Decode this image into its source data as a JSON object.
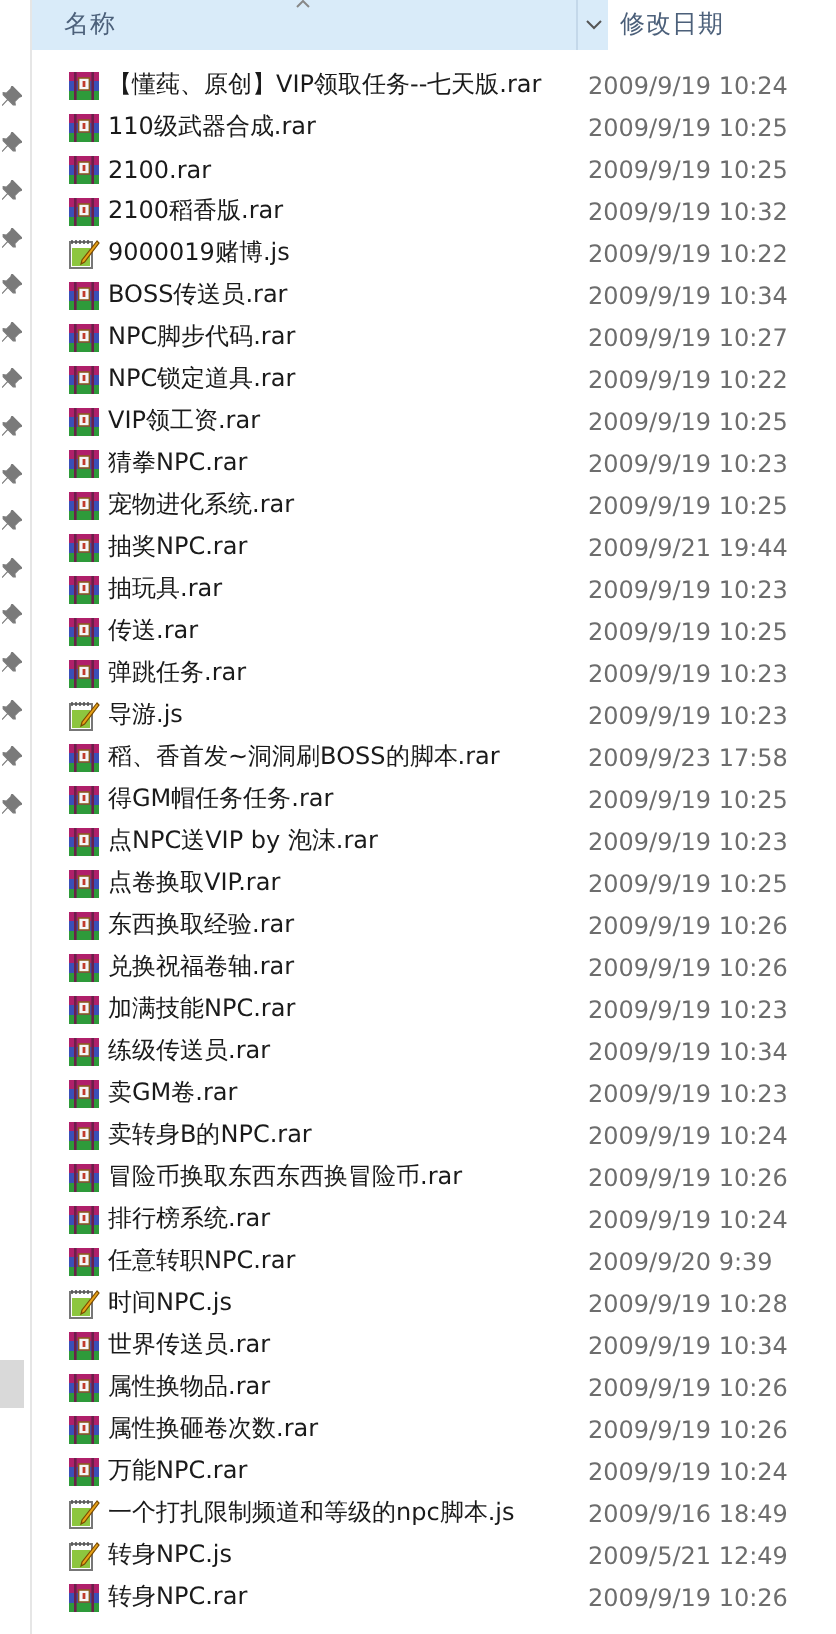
{
  "nav_pane": {
    "items": [
      {
        "pinned": true
      },
      {
        "pinned": true
      },
      {
        "pinned": true
      },
      {
        "pinned": true
      },
      {
        "pinned": true
      },
      {
        "pinned": true
      },
      {
        "pinned": true
      },
      {
        "pinned": true
      },
      {
        "pinned": true
      },
      {
        "pinned": true
      },
      {
        "pinned": true
      },
      {
        "pinned": true
      },
      {
        "pinned": true
      },
      {
        "pinned": true
      },
      {
        "pinned": true
      },
      {
        "pinned": true
      }
    ],
    "selected_item": {
      "selected": true
    }
  },
  "columns": [
    {
      "label": "名称",
      "hovered": true,
      "sorted": true
    },
    {
      "label": "修改日期",
      "hovered": false,
      "sorted": false
    }
  ],
  "files": [
    {
      "name": "【懂莼、原创】VIP领取任务--七天版.rar",
      "kind": "rar",
      "modified": "2009/9/19 10:24"
    },
    {
      "name": "110级武器合成.rar",
      "kind": "rar",
      "modified": "2009/9/19 10:25"
    },
    {
      "name": "2100.rar",
      "kind": "rar",
      "modified": "2009/9/19 10:25"
    },
    {
      "name": "2100稻香版.rar",
      "kind": "rar",
      "modified": "2009/9/19 10:32"
    },
    {
      "name": "9000019赌博.js",
      "kind": "js",
      "modified": "2009/9/19 10:22"
    },
    {
      "name": "BOSS传送员.rar",
      "kind": "rar",
      "modified": "2009/9/19 10:34"
    },
    {
      "name": "NPC脚步代码.rar",
      "kind": "rar",
      "modified": "2009/9/19 10:27"
    },
    {
      "name": "NPC锁定道具.rar",
      "kind": "rar",
      "modified": "2009/9/19 10:22"
    },
    {
      "name": "VIP领工资.rar",
      "kind": "rar",
      "modified": "2009/9/19 10:25"
    },
    {
      "name": "猜拳NPC.rar",
      "kind": "rar",
      "modified": "2009/9/19 10:23"
    },
    {
      "name": "宠物进化系统.rar",
      "kind": "rar",
      "modified": "2009/9/19 10:25"
    },
    {
      "name": "抽奖NPC.rar",
      "kind": "rar",
      "modified": "2009/9/21 19:44"
    },
    {
      "name": "抽玩具.rar",
      "kind": "rar",
      "modified": "2009/9/19 10:23"
    },
    {
      "name": "传送.rar",
      "kind": "rar",
      "modified": "2009/9/19 10:25"
    },
    {
      "name": "弹跳任务.rar",
      "kind": "rar",
      "modified": "2009/9/19 10:23"
    },
    {
      "name": "导游.js",
      "kind": "js",
      "modified": "2009/9/19 10:23"
    },
    {
      "name": "稻、香首发~洞洞刷BOSS的脚本.rar",
      "kind": "rar",
      "modified": "2009/9/23 17:58"
    },
    {
      "name": "得GM帽任务任务.rar",
      "kind": "rar",
      "modified": "2009/9/19 10:25"
    },
    {
      "name": "点NPC送VIP by 泡沫.rar",
      "kind": "rar",
      "modified": "2009/9/19 10:23"
    },
    {
      "name": "点卷换取VIP.rar",
      "kind": "rar",
      "modified": "2009/9/19 10:25"
    },
    {
      "name": "东西换取经验.rar",
      "kind": "rar",
      "modified": "2009/9/19 10:26"
    },
    {
      "name": "兑换祝福卷轴.rar",
      "kind": "rar",
      "modified": "2009/9/19 10:26"
    },
    {
      "name": "加满技能NPC.rar",
      "kind": "rar",
      "modified": "2009/9/19 10:23"
    },
    {
      "name": "练级传送员.rar",
      "kind": "rar",
      "modified": "2009/9/19 10:34"
    },
    {
      "name": "卖GM卷.rar",
      "kind": "rar",
      "modified": "2009/9/19 10:23"
    },
    {
      "name": "卖转身B的NPC.rar",
      "kind": "rar",
      "modified": "2009/9/19 10:24"
    },
    {
      "name": "冒险币换取东西东西换冒险币.rar",
      "kind": "rar",
      "modified": "2009/9/19 10:26"
    },
    {
      "name": "排行榜系统.rar",
      "kind": "rar",
      "modified": "2009/9/19 10:24"
    },
    {
      "name": "任意转职NPC.rar",
      "kind": "rar",
      "modified": "2009/9/20 9:39"
    },
    {
      "name": "时间NPC.js",
      "kind": "js",
      "modified": "2009/9/19 10:28"
    },
    {
      "name": "世界传送员.rar",
      "kind": "rar",
      "modified": "2009/9/19 10:34"
    },
    {
      "name": "属性换物品.rar",
      "kind": "rar",
      "modified": "2009/9/19 10:26"
    },
    {
      "name": "属性换砸卷次数.rar",
      "kind": "rar",
      "modified": "2009/9/19 10:26"
    },
    {
      "name": "万能NPC.rar",
      "kind": "rar",
      "modified": "2009/9/19 10:24"
    },
    {
      "name": "一个打扎限制频道和等级的npc脚本.js",
      "kind": "js",
      "modified": "2009/9/16 18:49"
    },
    {
      "name": "转身NPC.js",
      "kind": "js",
      "modified": "2009/5/21 12:49"
    },
    {
      "name": "转身NPC.rar",
      "kind": "rar",
      "modified": "2009/9/19 10:26"
    }
  ]
}
